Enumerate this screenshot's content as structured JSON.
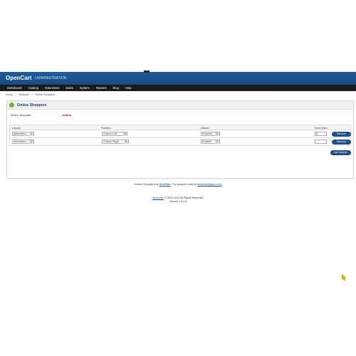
{
  "header": {
    "logo": "OpenCart",
    "subtitle": "ADMINISTRATION"
  },
  "menu": [
    "Dashboard",
    "Catalog",
    "Extensions",
    "Sales",
    "System",
    "Reports",
    "Blog",
    "Help"
  ],
  "breadcrumb": [
    "Home",
    "::",
    "Modules",
    "::",
    "Online Shoppers"
  ],
  "panel": {
    "title": "Online Shoppers",
    "template_label": "Active Template:",
    "template_value": "default",
    "columns": {
      "layout": "Layout:",
      "position": "Position:",
      "status": "Status:",
      "sort_order": "Sort Order:"
    },
    "rows": [
      {
        "layout": "Information",
        "position": "Column Left",
        "status": "Enabled",
        "sort_order": "5",
        "remove": "Remove"
      },
      {
        "layout": "Information",
        "position": "Column Right",
        "status": "Enabled",
        "sort_order": "",
        "remove": "Remove"
      }
    ],
    "add_button": "Add Module"
  },
  "footer": {
    "line1_prefix": "Online Shoppers by",
    "line1_author": "BestBitte",
    "line1_mid": ". For support email to",
    "line1_email": "bestbitte@gmx.com",
    "line2_brand": "OpenCart",
    "line2_rest": "© 2009-2012 All Rights Reserved.",
    "line3": "Version 1.5.1.3"
  },
  "colors": {
    "header_blue": "#1f5d9b",
    "menu_black": "#1a1a1a",
    "button_blue": "#1f4e8c",
    "accent_red": "#c21a1a"
  }
}
